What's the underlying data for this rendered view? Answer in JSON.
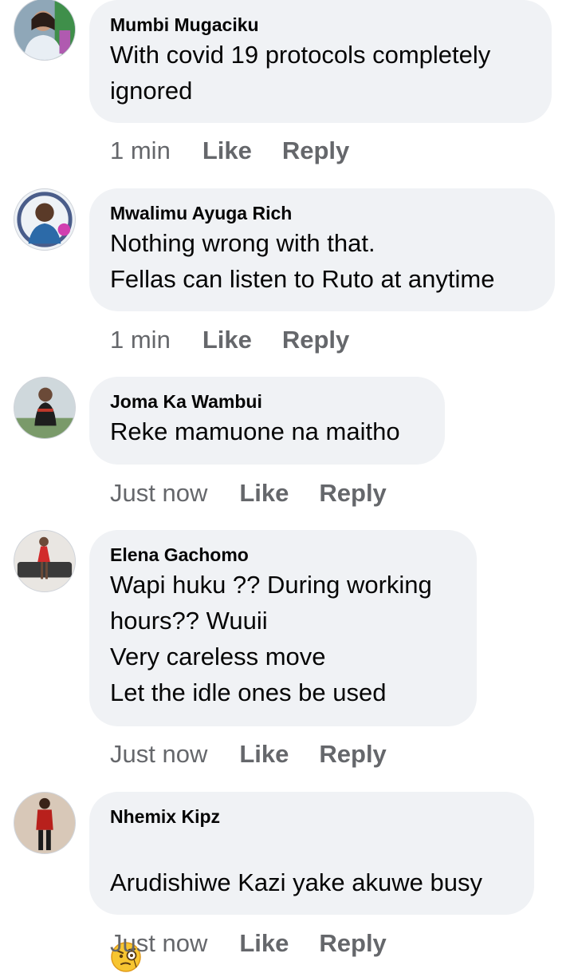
{
  "comments": [
    {
      "author": "Mumbi Mugaciku",
      "text": "With covid 19 protocols completely\nignored",
      "time": "1 min",
      "like": "Like",
      "reply": "Reply"
    },
    {
      "author": "Mwalimu Ayuga Rich",
      "text": "Nothing wrong with that.\nFellas can listen to Ruto at anytime",
      "time": "1 min",
      "like": "Like",
      "reply": "Reply"
    },
    {
      "author": "Joma Ka Wambui",
      "text": "Reke mamuone na maitho",
      "time": "Just now",
      "like": "Like",
      "reply": "Reply"
    },
    {
      "author": "Elena Gachomo",
      "text": "Wapi huku ?? During working\nhours?? Wuuii\nVery careless move\nLet the idle ones be used",
      "time": "Just now",
      "like": "Like",
      "reply": "Reply"
    },
    {
      "author": "Nhemix Kipz",
      "text": "Arudishiwe Kazi yake akuwe busy",
      "emoji": "face-with-monocle-icon",
      "time": "Just now",
      "like": "Like",
      "reply": "Reply"
    }
  ],
  "colors": {
    "bubble": "#f0f2f5",
    "text": "#050505",
    "meta": "#65676b"
  }
}
